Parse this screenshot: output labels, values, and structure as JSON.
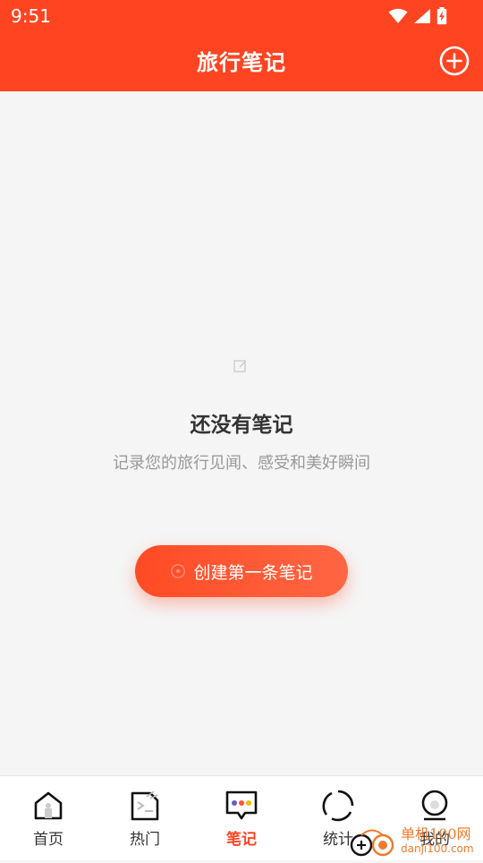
{
  "status_bar": {
    "time": "9:51",
    "icons": [
      "wifi-icon",
      "signal-icon",
      "battery-charging-icon"
    ]
  },
  "header": {
    "title": "旅行笔记",
    "add_icon": "plus-circle-icon",
    "color": "#ff4422"
  },
  "empty_state": {
    "icon": "edit-note-icon",
    "title": "还没有笔记",
    "description": "记录您的旅行见闻、感受和美好瞬间",
    "button_icon": "plus-circle-icon",
    "button_label": "创建第一条笔记"
  },
  "bottom_nav": {
    "items": [
      {
        "label": "首页",
        "icon": "home-icon",
        "active": false
      },
      {
        "label": "热门",
        "icon": "hot-icon",
        "active": false
      },
      {
        "label": "笔记",
        "icon": "notes-chat-icon",
        "active": true
      },
      {
        "label": "统计",
        "icon": "stats-ring-icon",
        "active": false
      },
      {
        "label": "我的",
        "icon": "profile-icon",
        "active": false
      }
    ],
    "active_color": "#ff4422"
  },
  "watermark": {
    "cn": "单机100网",
    "en": "danji100.com"
  }
}
